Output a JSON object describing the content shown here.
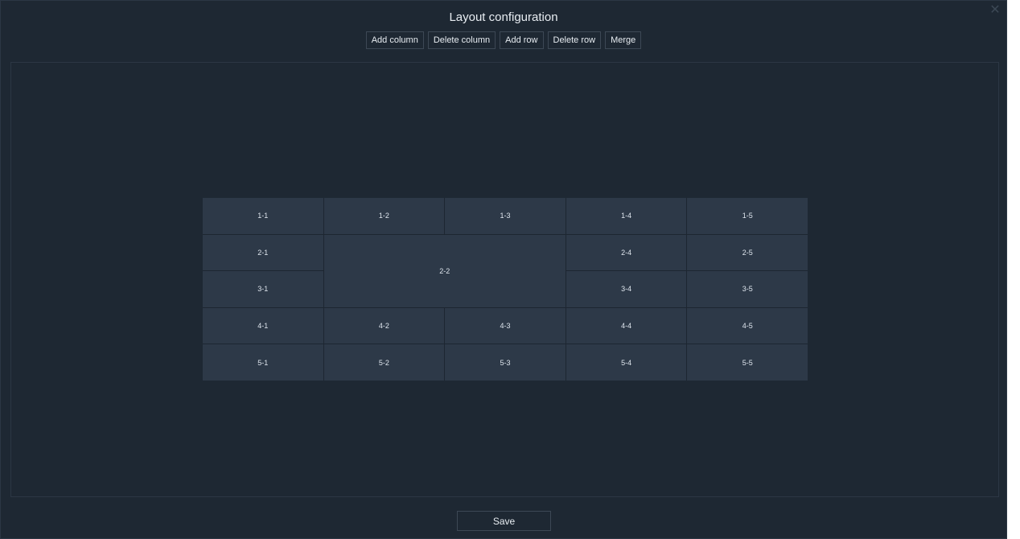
{
  "dialog": {
    "title": "Layout configuration",
    "close_icon": "close-icon"
  },
  "toolbar": {
    "add_column": "Add column",
    "delete_column": "Delete column",
    "add_row": "Add row",
    "delete_row": "Delete row",
    "merge": "Merge"
  },
  "grid": {
    "rows": 5,
    "columns": 5,
    "merged": [
      {
        "label": "2-2",
        "row": 2,
        "column": 2,
        "rowspan": 2,
        "colspan": 2
      }
    ],
    "cells": {
      "c1_1": "1-1",
      "c1_2": "1-2",
      "c1_3": "1-3",
      "c1_4": "1-4",
      "c1_5": "1-5",
      "c2_1": "2-1",
      "c2_2": "2-2",
      "c2_4": "2-4",
      "c2_5": "2-5",
      "c3_1": "3-1",
      "c3_4": "3-4",
      "c3_5": "3-5",
      "c4_1": "4-1",
      "c4_2": "4-2",
      "c4_3": "4-3",
      "c4_4": "4-4",
      "c4_5": "4-5",
      "c5_1": "5-1",
      "c5_2": "5-2",
      "c5_3": "5-3",
      "c5_4": "5-4",
      "c5_5": "5-5"
    }
  },
  "footer": {
    "save_label": "Save"
  },
  "colors": {
    "background": "#1e2833",
    "cell": "#2d3948",
    "border": "#3d4855",
    "text": "#e8edf2"
  }
}
